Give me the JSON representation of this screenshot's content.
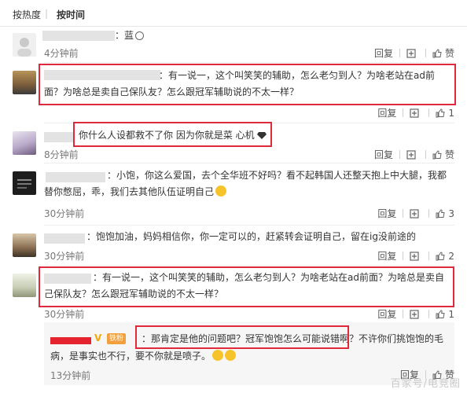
{
  "sort": {
    "hot": "按热度",
    "separator": "|",
    "time": "按时间"
  },
  "actions": {
    "reply": "回复",
    "like": "赞"
  },
  "comments": [
    {
      "text": "：蓝",
      "time": "4分钟前",
      "likes": ""
    },
    {
      "text": "：有一说一，这个叫笑笑的辅助，怎么老匀到人？为啥老站在ad前面？为啥总是卖自己保队友？怎么跟冠军辅助说的不太一样？",
      "time": "",
      "likes": "1"
    },
    {
      "text": "你什么人设都救不了你 因为你就是菜 心机",
      "time": "8分钟前",
      "likes": ""
    },
    {
      "text": "：小饱，你这么爱国，去个全华班不好吗？看不起韩国人还整天抱上中大腿，我都替你憋屈，乖，我们去其他队伍证明自己",
      "time": "30分钟前",
      "likes": "3"
    },
    {
      "text": "：饱饱加油，妈妈相信你，你一定可以的，赶紧转会证明自己，留在ig没前途的",
      "time": "30分钟前",
      "likes": "2"
    },
    {
      "text": "：有一说一，这个叫笑笑的辅助，怎么老匀到人？为啥老站在ad前面？为啥总是卖自己保队友？怎么跟冠军辅助说的不太一样？",
      "time": "30分钟前",
      "likes": "1"
    }
  ],
  "reply": {
    "badge": "V",
    "fan_badge": "铁粉",
    "text": "：那肯定是他的问题吧？冠军饱饱怎么可能说错啊？不许你们挑饱饱的毛病，是事实也不行，要不你就是喷子。",
    "time": "13分钟前"
  },
  "watermark": "百家号/电竞圈",
  "colors": {
    "highlight_box": "#e0293a",
    "name_redaction": "#e5232e"
  }
}
